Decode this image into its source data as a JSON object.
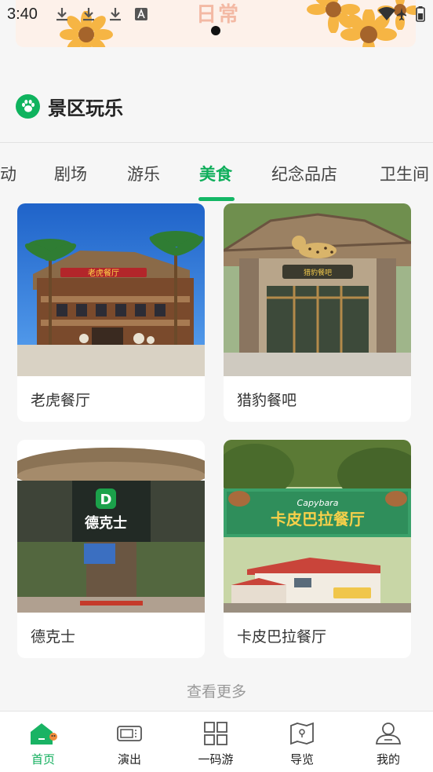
{
  "status_bar": {
    "time": "3:40"
  },
  "banner": {
    "text": "日常"
  },
  "section": {
    "title": "景区玩乐"
  },
  "tabs": [
    {
      "label": "动"
    },
    {
      "label": "剧场"
    },
    {
      "label": "游乐"
    },
    {
      "label": "美食",
      "active": true
    },
    {
      "label": "纪念品店"
    },
    {
      "label": "卫生间"
    }
  ],
  "cards": [
    {
      "label": "老虎餐厅",
      "sign": "老虎餐厅"
    },
    {
      "label": "猎豹餐吧",
      "sign": "猎豹餐吧"
    },
    {
      "label": "德克士",
      "sign": "德克士"
    },
    {
      "label": "卡皮巴拉餐厅",
      "sign": "卡皮巴拉餐厅",
      "sign_en": "Capybara"
    }
  ],
  "more_link": "查看更多",
  "bottom_nav": [
    {
      "label": "首页",
      "icon": "home-icon",
      "active": true
    },
    {
      "label": "演出",
      "icon": "ticket-icon"
    },
    {
      "label": "一码游",
      "icon": "grid-icon"
    },
    {
      "label": "导览",
      "icon": "map-icon"
    },
    {
      "label": "我的",
      "icon": "user-icon"
    }
  ],
  "colors": {
    "accent": "#0fae5b",
    "background": "#f6f6f6"
  }
}
